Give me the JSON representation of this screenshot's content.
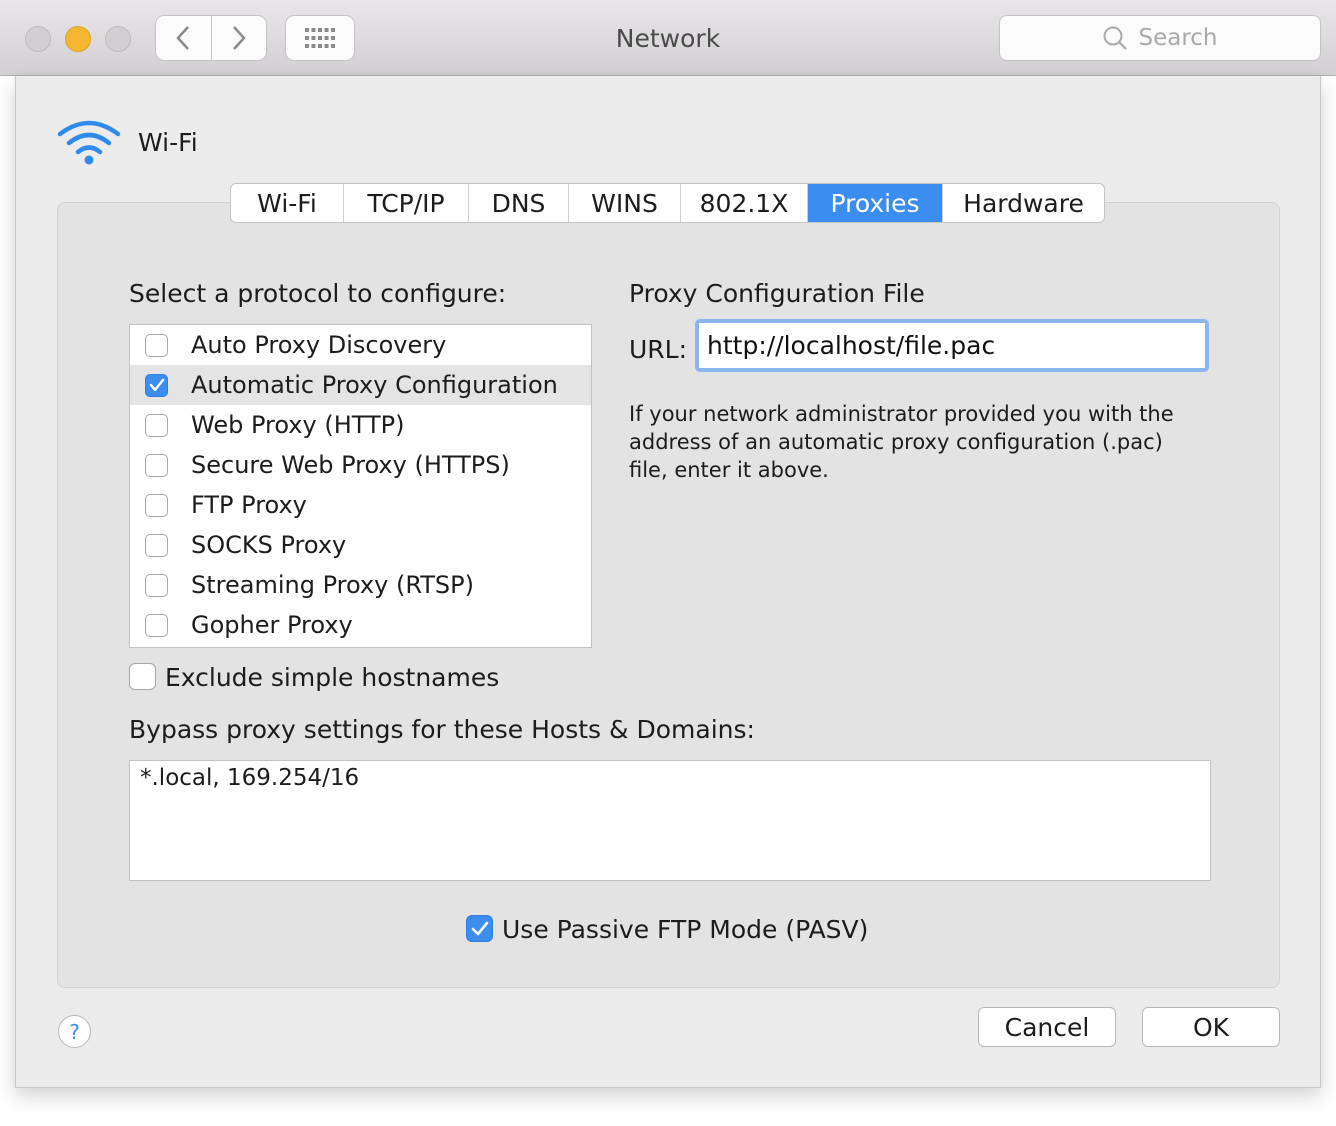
{
  "window": {
    "title": "Network"
  },
  "toolbar": {
    "search_placeholder": "Search"
  },
  "service": {
    "name": "Wi-Fi"
  },
  "tabs": [
    {
      "label": "Wi-Fi"
    },
    {
      "label": "TCP/IP"
    },
    {
      "label": "DNS"
    },
    {
      "label": "WINS"
    },
    {
      "label": "802.1X"
    },
    {
      "label": "Proxies",
      "active": true
    },
    {
      "label": "Hardware"
    }
  ],
  "protocols": {
    "heading": "Select a protocol to configure:",
    "items": [
      {
        "label": "Auto Proxy Discovery",
        "checked": false
      },
      {
        "label": "Automatic Proxy Configuration",
        "checked": true,
        "selected": true
      },
      {
        "label": "Web Proxy (HTTP)",
        "checked": false
      },
      {
        "label": "Secure Web Proxy (HTTPS)",
        "checked": false
      },
      {
        "label": "FTP Proxy",
        "checked": false
      },
      {
        "label": "SOCKS Proxy",
        "checked": false
      },
      {
        "label": "Streaming Proxy (RTSP)",
        "checked": false
      },
      {
        "label": "Gopher Proxy",
        "checked": false
      }
    ]
  },
  "pac": {
    "heading": "Proxy Configuration File",
    "url_label": "URL:",
    "url_value": "http://localhost/file.pac",
    "help": "If your network administrator provided you with the address of an automatic proxy configuration (.pac) file, enter it above."
  },
  "exclude_simple_hostnames": {
    "label": "Exclude simple hostnames",
    "checked": false
  },
  "bypass": {
    "label": "Bypass proxy settings for these Hosts & Domains:",
    "value": "*.local, 169.254/16"
  },
  "passive_ftp": {
    "label": "Use Passive FTP Mode (PASV)",
    "checked": true
  },
  "buttons": {
    "help": "?",
    "cancel": "Cancel",
    "ok": "OK"
  },
  "colors": {
    "accent": "#3b8df0",
    "minimize": "#f5b72f"
  }
}
